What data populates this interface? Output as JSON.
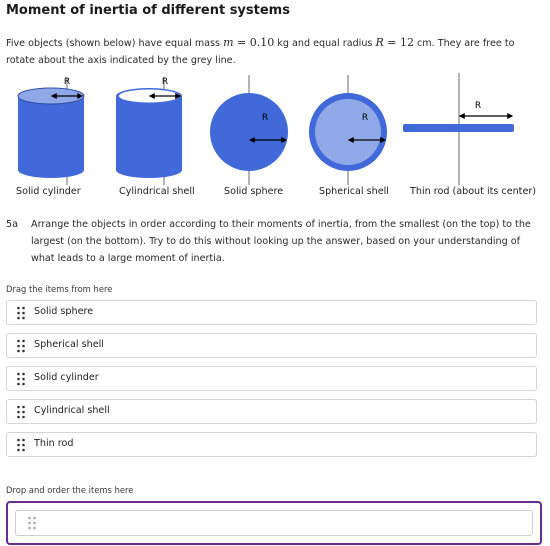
{
  "title": "Moment of inertia of different systems",
  "intro": {
    "p1": "Five objects (shown below) have equal mass ",
    "m_sym": "m",
    "eq1": " = 0.10",
    "mass_unit": " kg and equal radius ",
    "r_sym": "R",
    "eq2": " = 12",
    "p2": " cm. They are free to rotate about the axis indicated by the grey line."
  },
  "figure": {
    "radius_label": "R",
    "colors": {
      "blue": "#4169d9",
      "light_blue": "#8fa9e8",
      "dark_edge": "#2e4fa8",
      "axis_grey": "#9a9a9a"
    }
  },
  "objects": [
    "Solid cylinder",
    "Cylindrical shell",
    "Solid sphere",
    "Spherical shell",
    "Thin rod (about its center)"
  ],
  "question": {
    "number": "5a",
    "text": "Arrange the objects in order according to their moments of inertia, from the smallest (on the top) to the largest (on the bottom). Try to do this without looking up the answer, based on your understanding of what leads to a large moment of inertia."
  },
  "drag_zone": {
    "label": "Drag the items from here",
    "items": [
      "Solid sphere",
      "Spherical shell",
      "Solid cylinder",
      "Cylindrical shell",
      "Thin rod"
    ]
  },
  "drop_zone": {
    "label": "Drop and order the items here"
  },
  "icons": {
    "grip": "drag-handle-icon"
  }
}
